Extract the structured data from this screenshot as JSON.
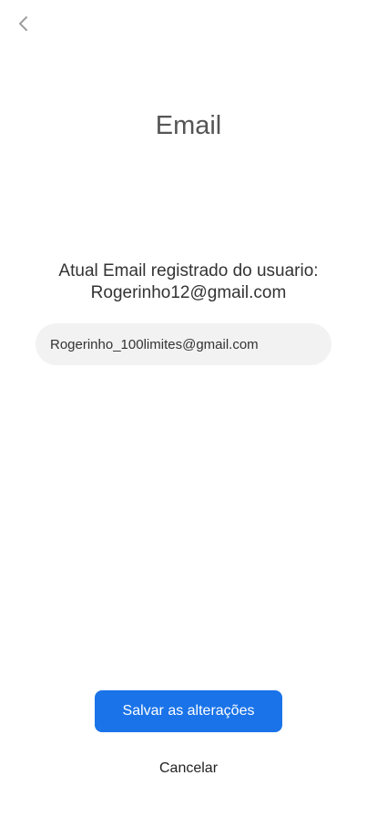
{
  "header": {
    "back_icon": "chevron-left-icon",
    "title": "Email"
  },
  "current_email": {
    "label": "Atual Email registrado do usuario:",
    "value": "Rogerinho12@gmail.com"
  },
  "email_input": {
    "value": "Rogerinho_100limites@gmail.com"
  },
  "actions": {
    "save_label": "Salvar as alterações",
    "cancel_label": "Cancelar"
  },
  "colors": {
    "primary": "#1a73e8",
    "input_background": "#f2f2f2",
    "title_text": "#555555"
  }
}
